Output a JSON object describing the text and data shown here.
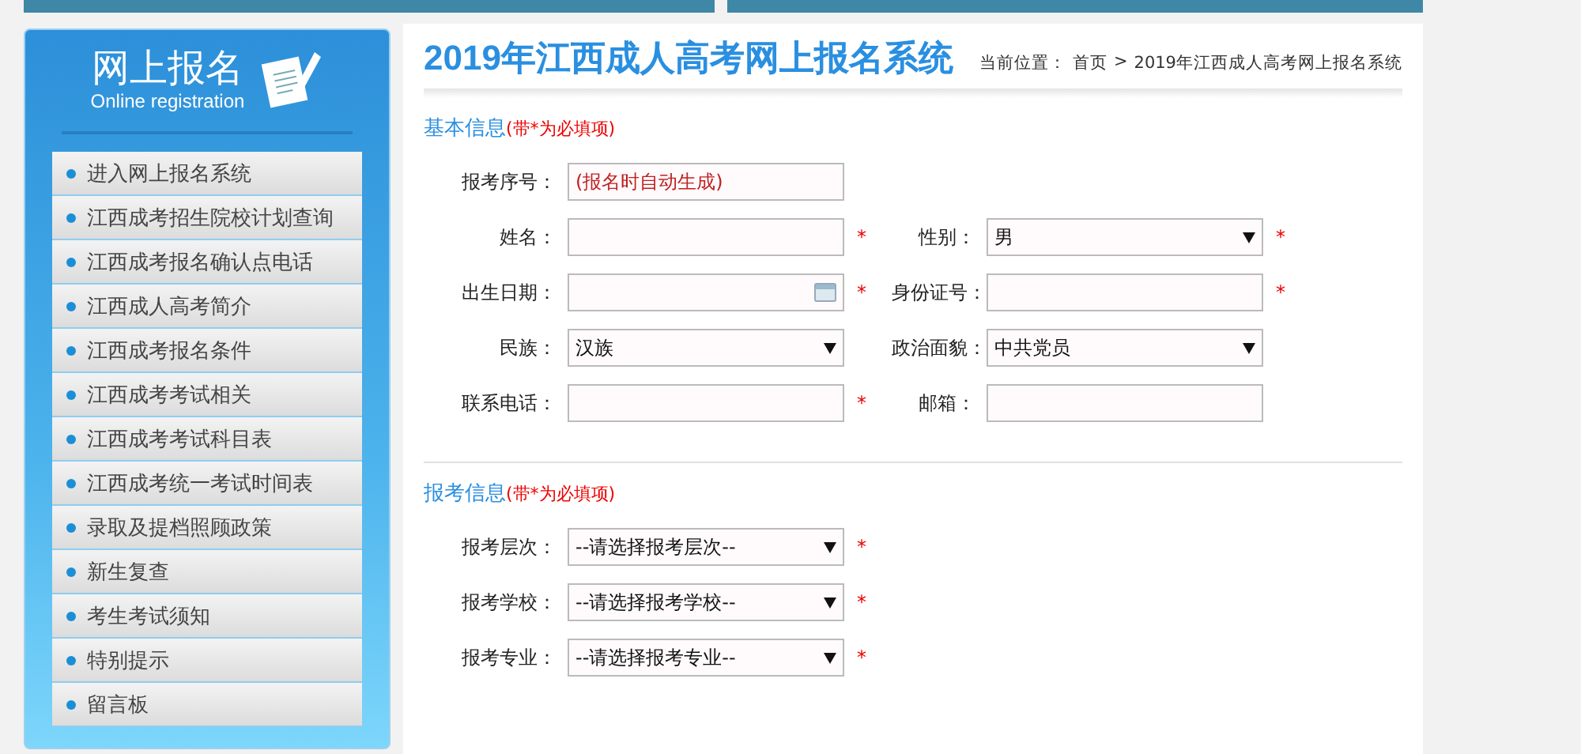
{
  "sidebar": {
    "title": "网上报名",
    "subtitle": "Online registration",
    "items": [
      {
        "label": "进入网上报名系统"
      },
      {
        "label": "江西成考招生院校计划查询"
      },
      {
        "label": "江西成考报名确认点电话"
      },
      {
        "label": "江西成人高考简介"
      },
      {
        "label": "江西成考报名条件"
      },
      {
        "label": "江西成考考试相关"
      },
      {
        "label": "江西成考考试科目表"
      },
      {
        "label": "江西成考统一考试时间表"
      },
      {
        "label": "录取及提档照顾政策"
      },
      {
        "label": "新生复查"
      },
      {
        "label": "考生考试须知"
      },
      {
        "label": "特别提示"
      },
      {
        "label": "留言板"
      }
    ]
  },
  "header": {
    "title": "2019年江西成人高考网上报名系统",
    "breadcrumb_label": "当前位置：",
    "breadcrumb": [
      "首页",
      "2019年江西成人高考网上报名系统"
    ],
    "separator": ">"
  },
  "sections": [
    {
      "title": "基本信息",
      "note": "(带*为必填项)",
      "rows": [
        [
          {
            "label": "报考序号：",
            "kind": "auto",
            "value": "(报名时自动生成)"
          }
        ],
        [
          {
            "label": "姓名：",
            "kind": "text",
            "mark": "*"
          },
          {
            "label": "性别：",
            "kind": "select",
            "value": "男",
            "mark": "*"
          }
        ],
        [
          {
            "label": "出生日期：",
            "kind": "date",
            "mark": "*"
          },
          {
            "label": "身份证号：",
            "kind": "text",
            "mark": "*"
          }
        ],
        [
          {
            "label": "民族：",
            "kind": "select",
            "value": "汉族"
          },
          {
            "label": "政治面貌：",
            "kind": "select",
            "value": "中共党员"
          }
        ],
        [
          {
            "label": "联系电话：",
            "kind": "text",
            "mark": "*"
          },
          {
            "label": "邮箱：",
            "kind": "text"
          }
        ]
      ]
    },
    {
      "title": "报考信息",
      "note": "(带*为必填项)",
      "rows": [
        [
          {
            "label": "报考层次：",
            "kind": "select",
            "value": "--请选择报考层次--",
            "mark": "*"
          }
        ],
        [
          {
            "label": "报考学校：",
            "kind": "select",
            "value": "--请选择报考学校--",
            "mark": "*"
          }
        ],
        [
          {
            "label": "报考专业：",
            "kind": "select",
            "value": "--请选择报考专业--",
            "mark": "*"
          }
        ]
      ]
    }
  ]
}
